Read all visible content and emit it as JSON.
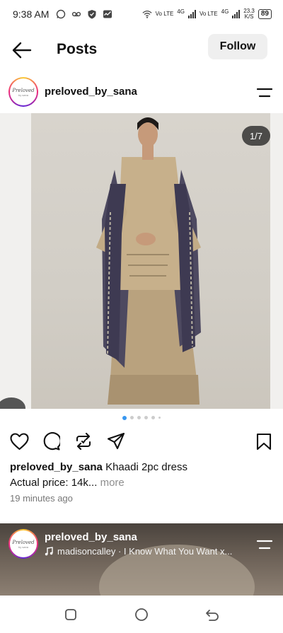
{
  "status_bar": {
    "time": "9:38 AM",
    "sim1": "Vo LTE",
    "sim1_net": "4G",
    "sim2": "Vo LTE",
    "sim2_net": "4G",
    "speed_value": "23.3",
    "speed_unit": "K/S",
    "battery": "89",
    "icons": [
      "whatsapp-icon",
      "voicemail-icon",
      "shield-icon",
      "activity-icon",
      "wifi-icon"
    ]
  },
  "header": {
    "title": "Posts",
    "follow_label": "Follow"
  },
  "post": {
    "username": "preloved_by_sana",
    "avatar_text": "Preloved",
    "avatar_subtext": "by sana",
    "image_counter": "1/7",
    "carousel": {
      "total_dots": 6,
      "active_index": 0
    },
    "caption_username": "preloved_by_sana",
    "caption_text": "Khaadi 2pc dress",
    "caption_line2": "Actual price: 14k...",
    "more_label": "more",
    "timestamp": "19 minutes ago"
  },
  "next_post": {
    "username": "preloved_by_sana",
    "audio": "madisoncalley · I Know What You Want x..."
  },
  "colors": {
    "accent_blue": "#3897f0",
    "follow_bg": "#efefef",
    "muted_text": "#8e8e8e"
  }
}
